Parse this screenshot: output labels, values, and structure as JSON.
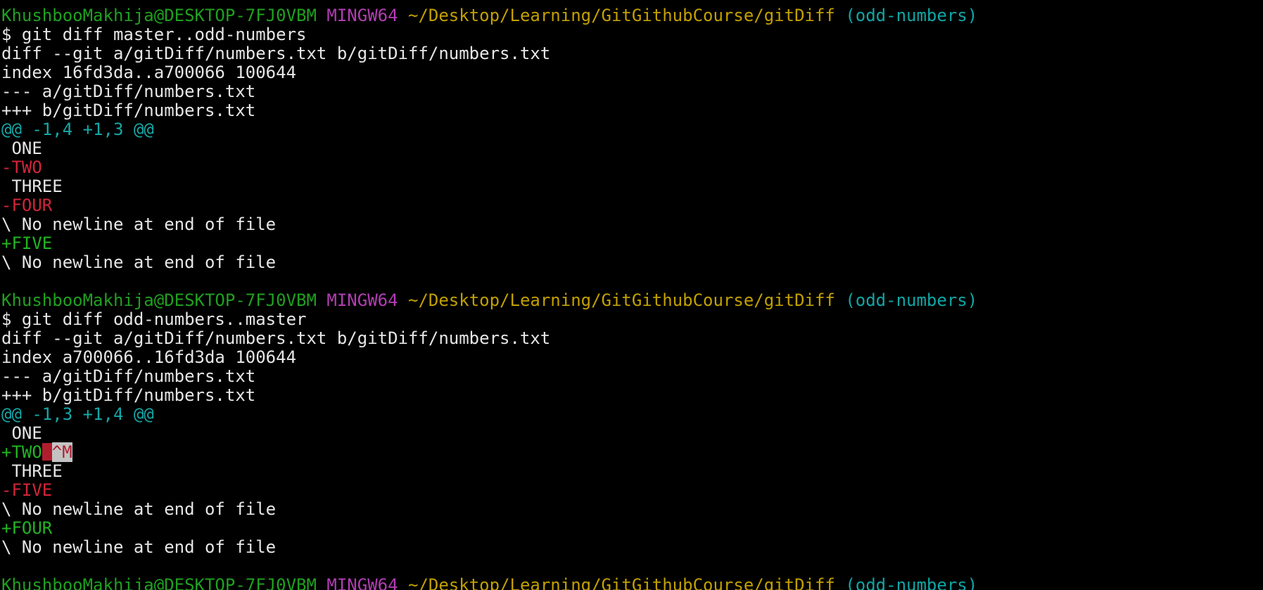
{
  "colors": {
    "background": "#000000",
    "user_host": "#1fa01f",
    "shell": "#b33db3",
    "path": "#c2a000",
    "branch": "#0fa6a6",
    "hunk_header": "#15a7a7",
    "removed": "#d2253a",
    "added": "#22b522",
    "text": "#e6e6e6"
  },
  "prompt": {
    "user_host": "KhushbooMakhija@DESKTOP-7FJ0VBM",
    "shell": "MINGW64",
    "path": "~/Desktop/Learning/GitGithubCourse/gitDiff",
    "branch": "(odd-numbers)"
  },
  "block1": {
    "command": "$ git diff master..odd-numbers",
    "diff_header": "diff --git a/gitDiff/numbers.txt b/gitDiff/numbers.txt",
    "index": "index 16fd3da..a700066 100644",
    "old_file": "--- a/gitDiff/numbers.txt",
    "new_file": "+++ b/gitDiff/numbers.txt",
    "hunk": "@@ -1,4 +1,3 @@",
    "lines": [
      {
        "type": "context",
        "text": " ONE"
      },
      {
        "type": "del",
        "text": "-TWO"
      },
      {
        "type": "context",
        "text": " THREE"
      },
      {
        "type": "del",
        "text": "-FOUR"
      },
      {
        "type": "note",
        "text": "\\ No newline at end of file"
      },
      {
        "type": "add",
        "text": "+FIVE"
      },
      {
        "type": "note",
        "text": "\\ No newline at end of file"
      }
    ]
  },
  "block2": {
    "command": "$ git diff odd-numbers..master",
    "diff_header": "diff --git a/gitDiff/numbers.txt b/gitDiff/numbers.txt",
    "index": "index a700066..16fd3da 100644",
    "old_file": "--- a/gitDiff/numbers.txt",
    "new_file": "+++ b/gitDiff/numbers.txt",
    "hunk": "@@ -1,3 +1,4 @@",
    "line_one": " ONE",
    "line_two": "+TWO",
    "line_two_cr": "^M",
    "line_three": " THREE",
    "line_four": "-FIVE",
    "line_five": "\\ No newline at end of file",
    "line_six": "+FOUR",
    "line_seven": "\\ No newline at end of file"
  }
}
